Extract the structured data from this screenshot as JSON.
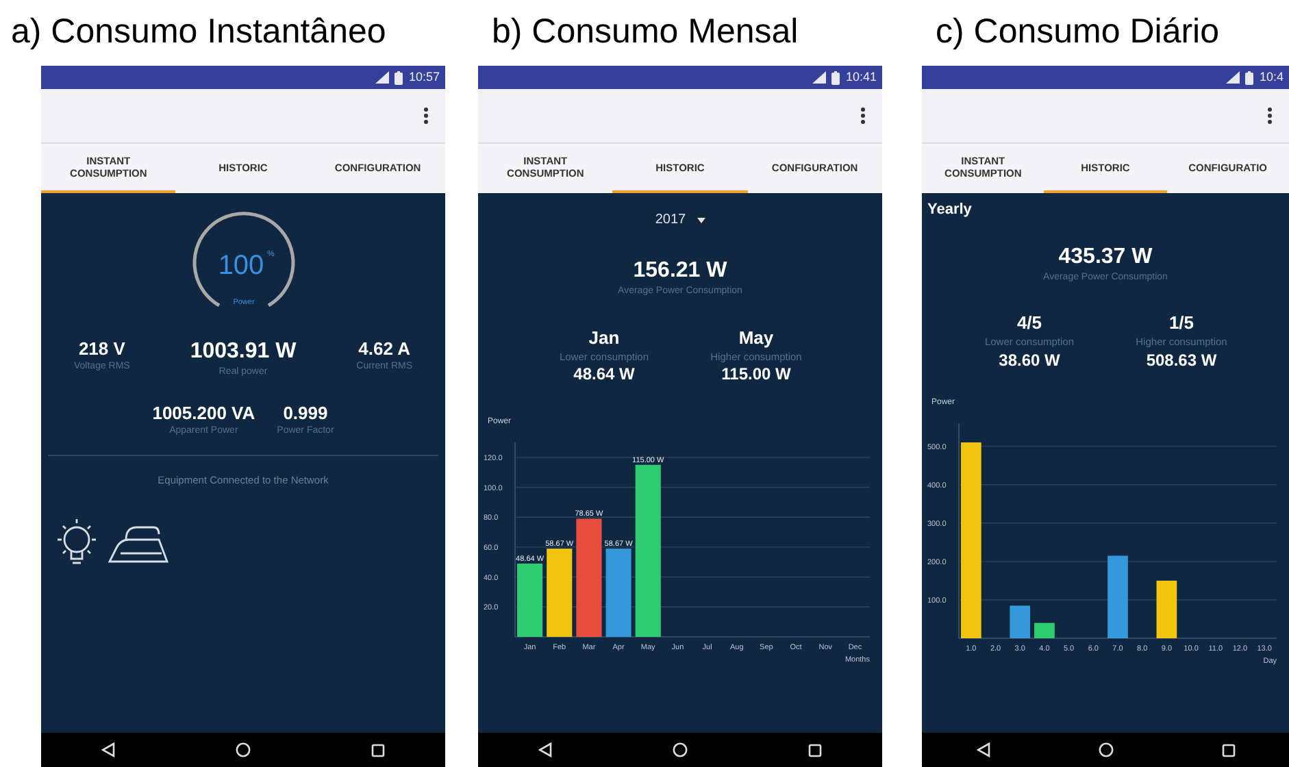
{
  "panels": [
    {
      "kind": "instant",
      "caption": "a) Consumo Instantâneo",
      "status_time": "10:57",
      "tabs": [
        {
          "label": "INSTANT CONSUMPTION",
          "selected": true
        },
        {
          "label": "HISTORIC",
          "selected": false
        },
        {
          "label": "CONFIGURATION",
          "selected": false
        }
      ],
      "gauge": {
        "value": "100",
        "unit": "%",
        "label": "Power"
      },
      "metrics": [
        {
          "value": "218 V",
          "label": "Voltage RMS"
        },
        {
          "value": "1003.91 W",
          "label": "Real power"
        },
        {
          "value": "4.62 A",
          "label": "Current RMS"
        }
      ],
      "metrics_row2": [
        {
          "value": "1005.200 VA",
          "label": "Apparent Power"
        },
        {
          "value": "0.999",
          "label": "Power Factor"
        }
      ],
      "equipment_title": "Equipment Connected to the Network"
    },
    {
      "kind": "monthly",
      "caption": "b) Consumo Mensal",
      "status_time": "10:41",
      "tabs": [
        {
          "label": "INSTANT CONSUMPTION",
          "selected": false
        },
        {
          "label": "HISTORIC",
          "selected": true
        },
        {
          "label": "CONFIGURATION",
          "selected": false
        }
      ],
      "year_selector": "2017",
      "average": {
        "value": "156.21 W",
        "label": "Average Power Consumption"
      },
      "extremes": [
        {
          "period": "Jan",
          "label": "Lower consumption",
          "value": "48.64 W"
        },
        {
          "period": "May",
          "label": "Higher consumption",
          "value": "115.00 W"
        }
      ],
      "chart_data": {
        "type": "bar",
        "xlabel": "Months",
        "ylabel": "Power",
        "categories": [
          "Jan",
          "Feb",
          "Mar",
          "Apr",
          "May",
          "Jun",
          "Jul",
          "Aug",
          "Sep",
          "Oct",
          "Nov",
          "Dec"
        ],
        "series": [
          {
            "color": "#2ecc71",
            "values": [
              49,
              null,
              null,
              null,
              115,
              null,
              null,
              null,
              null,
              null,
              null,
              null
            ]
          },
          {
            "color": "#f1c40f",
            "values": [
              null,
              59,
              null,
              null,
              null,
              null,
              null,
              null,
              null,
              null,
              null,
              null
            ]
          },
          {
            "color": "#e74c3c",
            "values": [
              null,
              null,
              79,
              null,
              null,
              null,
              null,
              null,
              null,
              null,
              null,
              null
            ]
          },
          {
            "color": "#3498db",
            "values": [
              null,
              null,
              null,
              59,
              null,
              null,
              null,
              null,
              null,
              null,
              null,
              null
            ]
          }
        ],
        "ylim": [
          0,
          130
        ],
        "grid": true,
        "yticks": [
          {
            "value": 20,
            "label": "20.0"
          },
          {
            "value": 40,
            "label": "40.0"
          },
          {
            "value": 60,
            "label": "60.0"
          },
          {
            "value": 80,
            "label": "80.0"
          },
          {
            "value": 100,
            "label": "100.0"
          },
          {
            "value": 120,
            "label": "120.0"
          }
        ],
        "value_labels": [
          "48.64 W",
          "58.67 W",
          "78.65 W",
          "58.67 W",
          "115.00 W",
          null,
          null,
          null,
          null,
          null,
          null,
          null
        ]
      }
    },
    {
      "kind": "daily",
      "caption": "c) Consumo Diário",
      "status_time": "10:4",
      "tabs": [
        {
          "label": "INSTANT CONSUMPTION",
          "selected": false
        },
        {
          "label": "HISTORIC",
          "selected": true
        },
        {
          "label": "CONFIGURATIO",
          "selected": false
        }
      ],
      "period_title": "Yearly",
      "average": {
        "value": "435.37 W",
        "label": "Average Power Consumption"
      },
      "extremes": [
        {
          "period": "4/5",
          "label": "Lower consumption",
          "value": "38.60 W"
        },
        {
          "period": "1/5",
          "label": "Higher consumption",
          "value": "508.63 W"
        }
      ],
      "chart_data": {
        "type": "bar",
        "xlabel": "Day",
        "ylabel": "Power",
        "categories": [
          "1.0",
          "2.0",
          "3.0",
          "4.0",
          "5.0",
          "6.0",
          "7.0",
          "8.0",
          "9.0",
          "10.0",
          "11.0",
          "12.0",
          "13.0"
        ],
        "series": [
          {
            "color": "#f1c40f",
            "values": [
              510,
              null,
              null,
              null,
              null,
              null,
              null,
              null,
              150,
              null,
              null,
              null,
              null
            ]
          },
          {
            "color": "#3498db",
            "values": [
              null,
              null,
              85,
              null,
              null,
              null,
              215,
              null,
              null,
              null,
              null,
              null,
              null
            ]
          },
          {
            "color": "#2ecc71",
            "values": [
              null,
              null,
              null,
              40,
              null,
              null,
              null,
              null,
              null,
              null,
              null,
              null,
              null
            ]
          }
        ],
        "ylim": [
          0,
          560
        ],
        "grid": true,
        "yticks": [
          {
            "value": 100,
            "label": "100.0"
          },
          {
            "value": 200,
            "label": "200.0"
          },
          {
            "value": 300,
            "label": "300.0"
          },
          {
            "value": 400,
            "label": "400.0"
          },
          {
            "value": 500,
            "label": "500.0"
          }
        ]
      }
    }
  ]
}
